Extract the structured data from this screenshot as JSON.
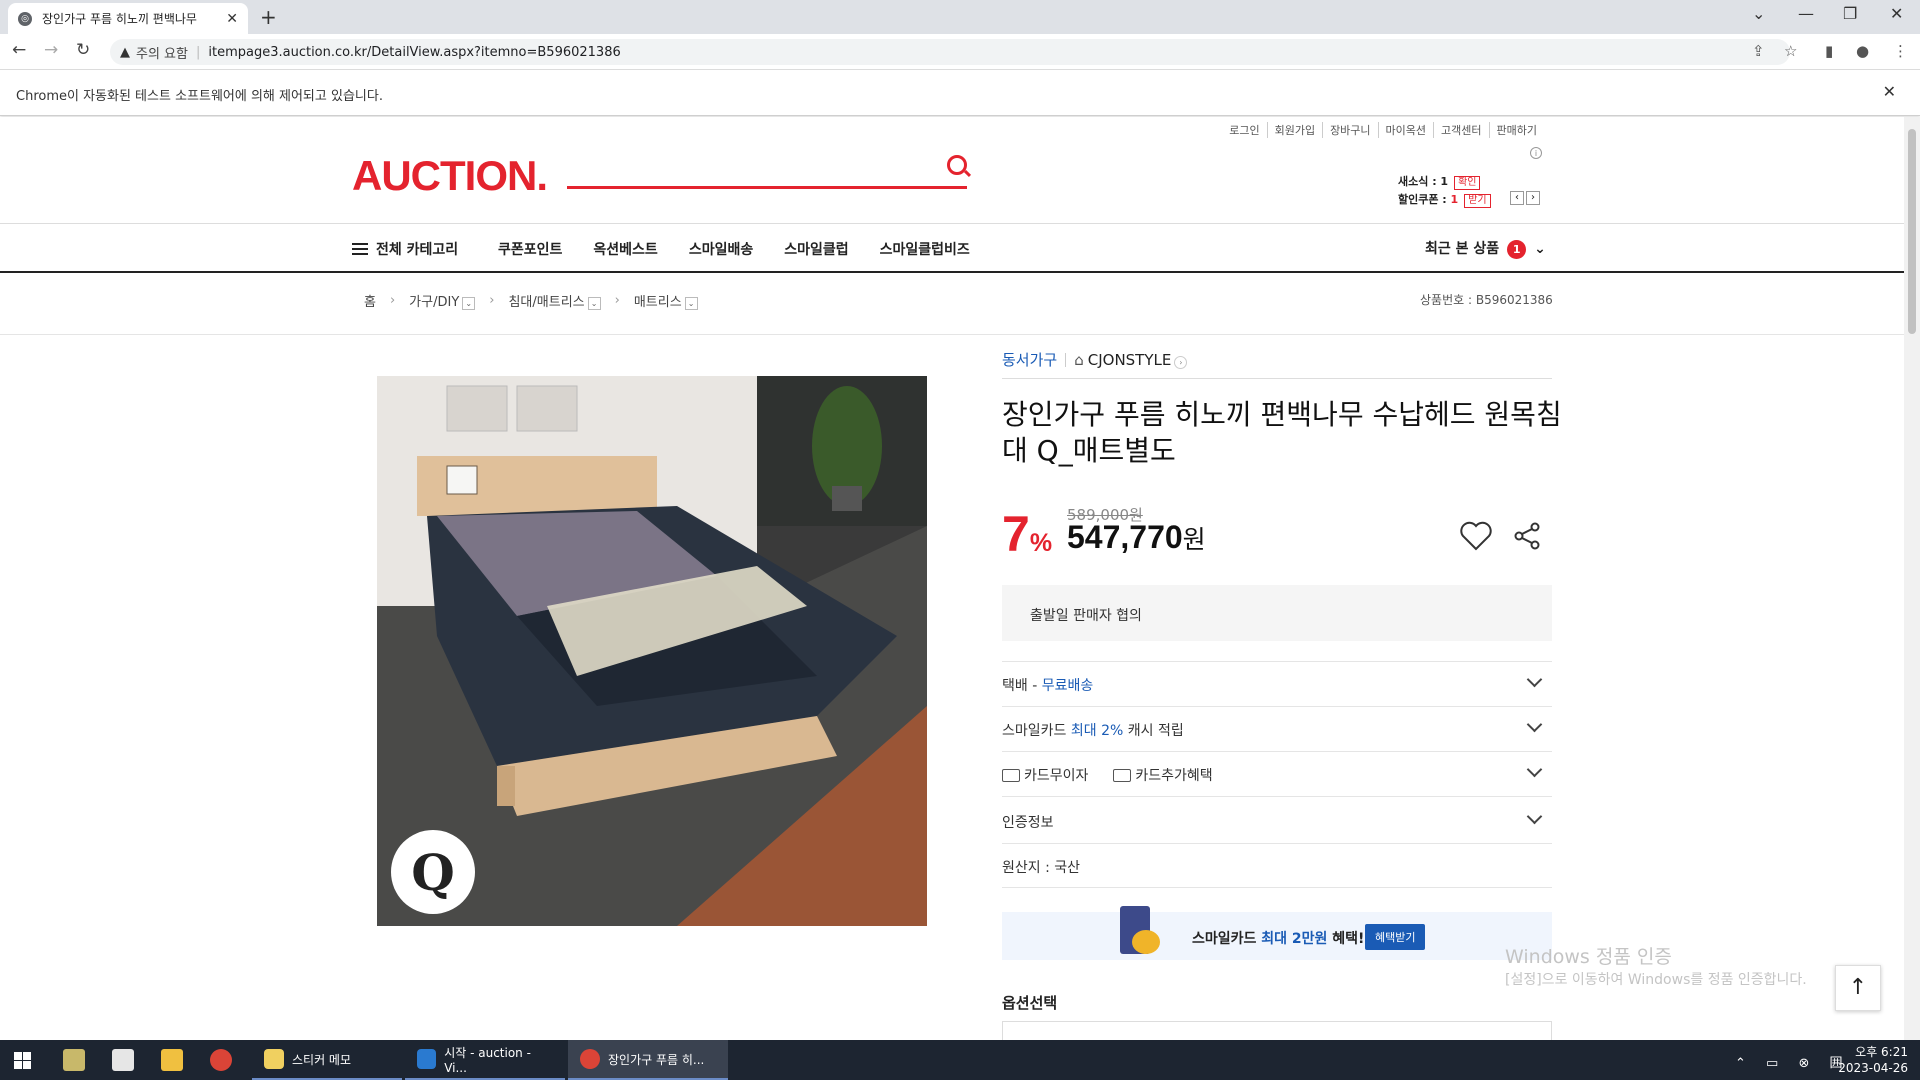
{
  "browser": {
    "tab_title": "장인가구 푸름 히노끼 편백나무",
    "security_label": "주의 요함",
    "url": "itempage3.auction.co.kr/DetailView.aspx?itemno=B596021386",
    "infobar_message": "Chrome이 자동화된 테스트 소프트웨어에 의해 제어되고 있습니다."
  },
  "header": {
    "util_links": [
      "로그인",
      "회원가입",
      "장바구니",
      "마이옥션",
      "고객센터",
      "판매하기"
    ],
    "logo": "AUCTION.",
    "news_label": "새소식 : 1",
    "news_btn": "확인",
    "coupon_label": "할인쿠폰 : ",
    "coupon_count": "1",
    "coupon_btn": "받기"
  },
  "gnb": {
    "all_categories": "전체 카테고리",
    "menu": [
      "쿠폰포인트",
      "옥션베스트",
      "스마일배송",
      "스마일클럽",
      "스마일클럽비즈"
    ],
    "recent_label": "최근 본 상품",
    "recent_count": "1"
  },
  "breadcrumb": {
    "home": "홈",
    "items": [
      "가구/DIY",
      "침대/매트리스",
      "매트리스"
    ],
    "product_no": "상품번호 : B596021386"
  },
  "product": {
    "seller": "동서가구",
    "store": "CJONSTYLE",
    "title": "장인가구 푸름 히노끼 편백나무 수납헤드 원목침대 Q_매트별도",
    "discount": "7",
    "discount_unit": "%",
    "original_price": "589,000원",
    "price": "547,770",
    "price_unit": "원",
    "ship_date": "출발일 판매자 협의",
    "delivery_label": "택배 - ",
    "delivery_value": "무료배송",
    "smile_card_pre": "스마일카드 ",
    "smile_card_hl": "최대 2%",
    "smile_card_post": " 캐시 적립",
    "card_interest": "카드무이자",
    "card_benefit": "카드추가혜택",
    "cert_info": "인증정보",
    "origin": "원산지 : 국산",
    "banner_pre": "스마일카드 ",
    "banner_hl": "최대 2만원",
    "banner_post": " 혜택!",
    "banner_btn": "혜택받기",
    "option_label": "옵션선택",
    "image_badge": "Q"
  },
  "watermark": {
    "line1": "Windows 정품 인증",
    "line2": "[설정]으로 이동하여 Windows를 정품 인증합니다."
  },
  "taskbar": {
    "apps": [
      "스티커 메모",
      "시작 - auction - Vi...",
      "장인가구 푸름 히..."
    ],
    "time": "오후 6:21",
    "date": "2023-04-26"
  }
}
